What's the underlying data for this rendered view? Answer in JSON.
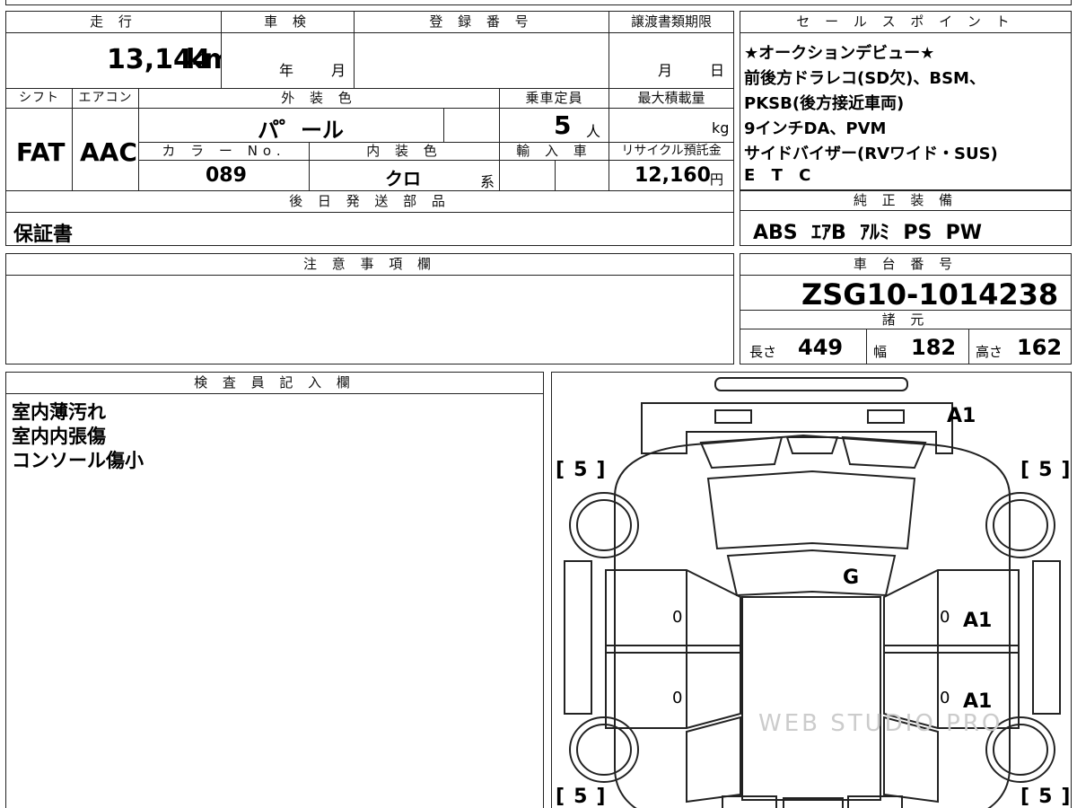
{
  "top_info": {
    "mileage_header": "走 行",
    "mileage_value": "13,144",
    "mileage_unit": "km",
    "inspection_header": "車 検",
    "inspection_year": "年",
    "inspection_month": "月",
    "registration_header": "登 録 番 号",
    "transfer_header": "譲渡書類期限",
    "transfer_month": "月",
    "transfer_day": "日",
    "shift_header": "シフト",
    "shift_value": "FAT",
    "ac_header": "エアコン",
    "ac_value": "AAC",
    "exterior_header": "外 装 色",
    "exterior_value": "パ゜ール",
    "capacity_header": "乗車定員",
    "capacity_value": "5",
    "capacity_unit": "人",
    "load_header": "最大積載量",
    "load_unit": "kg",
    "color_no_header": "カ ラ ー No.",
    "color_no_value": "089",
    "interior_header": "内 装 色",
    "interior_value": "クロ",
    "interior_suffix": "系",
    "import_header": "輸 入 車",
    "recycle_header": "リサイクル預託金",
    "recycle_value": "12,160",
    "recycle_unit": "円",
    "later_parts_header": "後 日 発 送 部 品",
    "later_parts_value": "保証書"
  },
  "sales_points": {
    "header": "セ ー ル ス ポ イ ン ト",
    "lines": [
      "★オークションデビュー★",
      "前後方ドラレコ(SD欠)、BSM、",
      "PKSB(後方接近車両)",
      "9インチDA、PVM",
      "サイドバイザー(RVワイド・SUS)",
      "E T C"
    ]
  },
  "equipment": {
    "header": "純 正 装 備",
    "value": "ABS  ｴｱB  ｱﾙﾐ  PS  PW"
  },
  "notes": {
    "header": "注 意 事 項 欄"
  },
  "chassis": {
    "header": "車 台 番 号",
    "value": "ZSG10-1014238"
  },
  "specs": {
    "header": "諸 元",
    "length_label": "長さ",
    "length_value": "449",
    "width_label": "幅",
    "width_value": "182",
    "height_label": "高さ",
    "height_value": "162"
  },
  "inspector": {
    "header": "検 査 員 記 入 欄",
    "lines": [
      "室内薄汚れ",
      "室内内張傷",
      "コンソール傷小"
    ]
  },
  "diagram": {
    "marks": {
      "rear": "A1",
      "windshield": "G",
      "right_front_door": "A1",
      "right_rear_door": "A1",
      "left_front_door_zero": "0",
      "left_rear_door_zero": "0",
      "right_front_door_zero": "0",
      "right_rear_door_zero": "0"
    },
    "tires": {
      "front_left": "5",
      "front_right": "5",
      "rear_left": "5",
      "rear_right": "5"
    },
    "watermark": "WEB STUDIO PRO"
  }
}
